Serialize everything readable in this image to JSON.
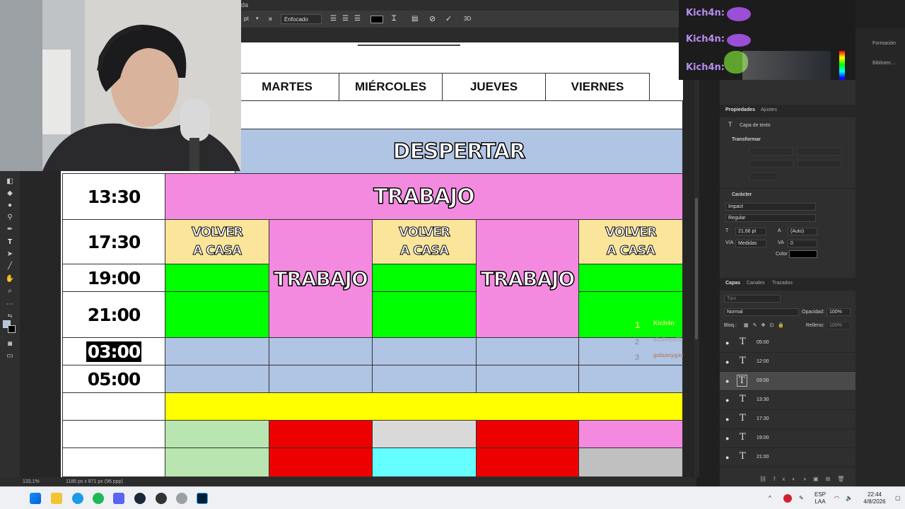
{
  "app": {
    "title_fragment": "da",
    "zoom": "133,1%",
    "doc_info": "1186 px x 871 px (96 ppp)"
  },
  "optionbar": {
    "size_unit": "pt",
    "antialias": "Enfocado",
    "aa_icon": "a",
    "threed": "3D"
  },
  "schedule": {
    "days": [
      "MARTES",
      "MIÉRCOLES",
      "JUEVES",
      "VIERNES"
    ],
    "times": [
      "13:30",
      "17:30",
      "19:00",
      "21:00",
      "03:00",
      "05:00"
    ],
    "despertar": "DESPERTAR",
    "trabajo": "TRABAJO",
    "volver": "VOLVER A CASA",
    "colors": {
      "despertar": "#b0c4e4",
      "trabajo": "#f48ae0",
      "volver": "#fbe59a",
      "green": "#00ff00",
      "sleep": "#b0c4e4",
      "yellow": "#ffff00",
      "lightgreen": "#b9e6b0",
      "red": "#ee0000",
      "gray": "#d9d9d9",
      "cyan": "#66ffff",
      "silver": "#c0c0c0"
    }
  },
  "chat": {
    "messages": [
      {
        "user": "Kich4n:"
      },
      {
        "user": "Kich4n:"
      },
      {
        "user": "Kich4n:"
      }
    ],
    "leaderboard": [
      {
        "rank": "1",
        "name": "Kich4n"
      },
      {
        "rank": "2",
        "name": "elcdemolibal"
      },
      {
        "rank": "3",
        "name": "galaaxygas"
      }
    ]
  },
  "properties_panel": {
    "tabs": [
      "Propiedades",
      "Ajustes"
    ],
    "layer_kind": "Capa de texto",
    "transform_title": "Transformar",
    "char_title": "Carácter",
    "font_family": "Impact",
    "font_style": "Regular",
    "font_size": "21,66 pt",
    "leading": "(Auto)",
    "kerning": "Medidas",
    "tracking": "0",
    "color_label": "Color",
    "color_value": "#000000"
  },
  "other_tabs": {
    "formacion": "Formación",
    "bibliotecas": "Bibliotec..."
  },
  "layers_panel": {
    "tabs": [
      "Capas",
      "Canales",
      "Trazados"
    ],
    "search_placeholder": "Tipo",
    "blend_mode": "Normal",
    "opacity_label": "Opacidad:",
    "opacity_value": "100%",
    "lock_label": "Bloq.:",
    "fill_label": "Relleno:",
    "fill_value": "100%",
    "layers": [
      "05:00",
      "12:00",
      "03:00",
      "13:30",
      "17:30",
      "19:00",
      "21:00"
    ],
    "selected_layer": "03:00"
  },
  "taskbar": {
    "lang_top": "ESP",
    "lang_bottom": "LAA",
    "time": "22:44",
    "date": "4/8/2026"
  }
}
